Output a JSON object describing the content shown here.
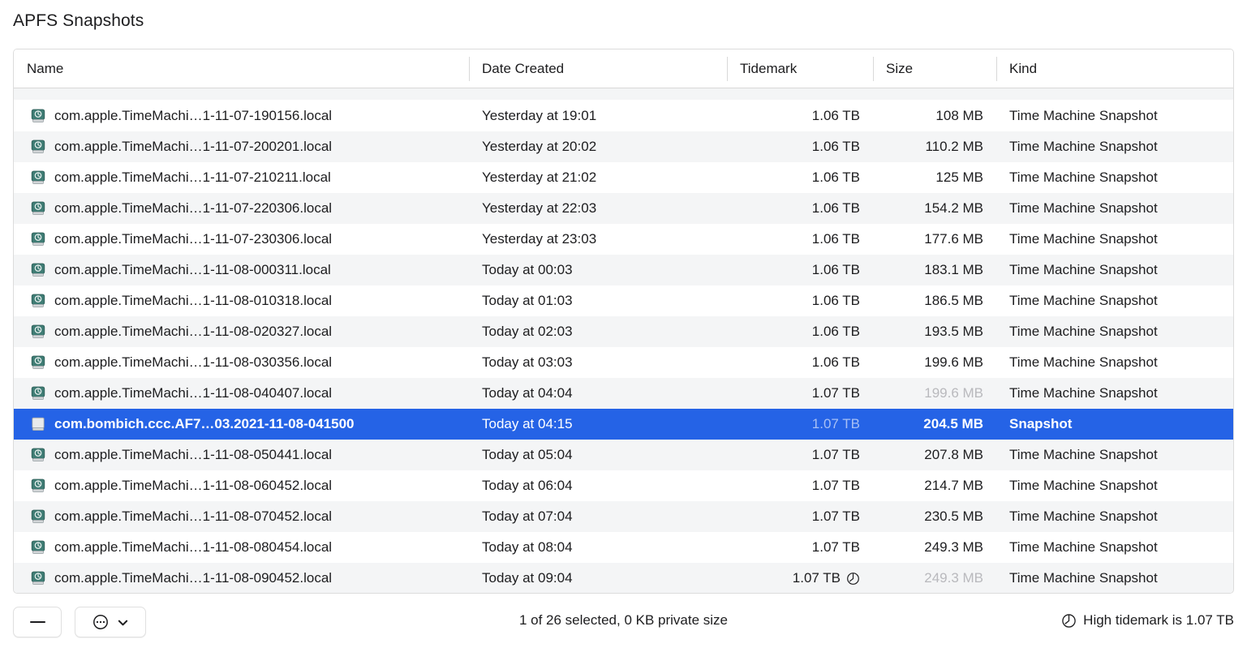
{
  "page_title": "APFS Snapshots",
  "colors": {
    "selection_blue": "#2563e6",
    "row_alt": "#f4f5f6",
    "text": "#1d1d1f",
    "dimmed_text": "#b9b9bd",
    "tm_disk_icon": "#3f7c74"
  },
  "table": {
    "columns": [
      {
        "key": "name",
        "label": "Name"
      },
      {
        "key": "date",
        "label": "Date Created"
      },
      {
        "key": "tidemark",
        "label": "Tidemark"
      },
      {
        "key": "size",
        "label": "Size"
      },
      {
        "key": "kind",
        "label": "Kind"
      }
    ],
    "rows": [
      {
        "icon": "time-machine-disk-icon",
        "name": "com.apple.TimeMachi…1-11-07-190156.local",
        "date": "Yesterday at 19:01",
        "tidemark": "1.06 TB",
        "tidemark_clock": false,
        "size": "108 MB",
        "size_dimmed": false,
        "kind": "Time Machine Snapshot",
        "selected": false
      },
      {
        "icon": "time-machine-disk-icon",
        "name": "com.apple.TimeMachi…1-11-07-200201.local",
        "date": "Yesterday at 20:02",
        "tidemark": "1.06 TB",
        "tidemark_clock": false,
        "size": "110.2 MB",
        "size_dimmed": false,
        "kind": "Time Machine Snapshot",
        "selected": false
      },
      {
        "icon": "time-machine-disk-icon",
        "name": "com.apple.TimeMachi…1-11-07-210211.local",
        "date": "Yesterday at 21:02",
        "tidemark": "1.06 TB",
        "tidemark_clock": false,
        "size": "125 MB",
        "size_dimmed": false,
        "kind": "Time Machine Snapshot",
        "selected": false
      },
      {
        "icon": "time-machine-disk-icon",
        "name": "com.apple.TimeMachi…1-11-07-220306.local",
        "date": "Yesterday at 22:03",
        "tidemark": "1.06 TB",
        "tidemark_clock": false,
        "size": "154.2 MB",
        "size_dimmed": false,
        "kind": "Time Machine Snapshot",
        "selected": false
      },
      {
        "icon": "time-machine-disk-icon",
        "name": "com.apple.TimeMachi…1-11-07-230306.local",
        "date": "Yesterday at 23:03",
        "tidemark": "1.06 TB",
        "tidemark_clock": false,
        "size": "177.6 MB",
        "size_dimmed": false,
        "kind": "Time Machine Snapshot",
        "selected": false
      },
      {
        "icon": "time-machine-disk-icon",
        "name": "com.apple.TimeMachi…1-11-08-000311.local",
        "date": "Today at 00:03",
        "tidemark": "1.06 TB",
        "tidemark_clock": false,
        "size": "183.1 MB",
        "size_dimmed": false,
        "kind": "Time Machine Snapshot",
        "selected": false
      },
      {
        "icon": "time-machine-disk-icon",
        "name": "com.apple.TimeMachi…1-11-08-010318.local",
        "date": "Today at 01:03",
        "tidemark": "1.06 TB",
        "tidemark_clock": false,
        "size": "186.5 MB",
        "size_dimmed": false,
        "kind": "Time Machine Snapshot",
        "selected": false
      },
      {
        "icon": "time-machine-disk-icon",
        "name": "com.apple.TimeMachi…1-11-08-020327.local",
        "date": "Today at 02:03",
        "tidemark": "1.06 TB",
        "tidemark_clock": false,
        "size": "193.5 MB",
        "size_dimmed": false,
        "kind": "Time Machine Snapshot",
        "selected": false
      },
      {
        "icon": "time-machine-disk-icon",
        "name": "com.apple.TimeMachi…1-11-08-030356.local",
        "date": "Today at 03:03",
        "tidemark": "1.06 TB",
        "tidemark_clock": false,
        "size": "199.6 MB",
        "size_dimmed": false,
        "kind": "Time Machine Snapshot",
        "selected": false
      },
      {
        "icon": "time-machine-disk-icon",
        "name": "com.apple.TimeMachi…1-11-08-040407.local",
        "date": "Today at 04:04",
        "tidemark": "1.07 TB",
        "tidemark_clock": false,
        "size": "199.6 MB",
        "size_dimmed": true,
        "kind": "Time Machine Snapshot",
        "selected": false
      },
      {
        "icon": "plain-disk-icon",
        "name": "com.bombich.ccc.AF7…03.2021-11-08-041500",
        "date": "Today at 04:15",
        "tidemark": "1.07 TB",
        "tidemark_clock": false,
        "size": "204.5 MB",
        "size_dimmed": false,
        "kind": "Snapshot",
        "selected": true,
        "tidemark_dimmed": true
      },
      {
        "icon": "time-machine-disk-icon",
        "name": "com.apple.TimeMachi…1-11-08-050441.local",
        "date": "Today at 05:04",
        "tidemark": "1.07 TB",
        "tidemark_clock": false,
        "size": "207.8 MB",
        "size_dimmed": false,
        "kind": "Time Machine Snapshot",
        "selected": false
      },
      {
        "icon": "time-machine-disk-icon",
        "name": "com.apple.TimeMachi…1-11-08-060452.local",
        "date": "Today at 06:04",
        "tidemark": "1.07 TB",
        "tidemark_clock": false,
        "size": "214.7 MB",
        "size_dimmed": false,
        "kind": "Time Machine Snapshot",
        "selected": false
      },
      {
        "icon": "time-machine-disk-icon",
        "name": "com.apple.TimeMachi…1-11-08-070452.local",
        "date": "Today at 07:04",
        "tidemark": "1.07 TB",
        "tidemark_clock": false,
        "size": "230.5 MB",
        "size_dimmed": false,
        "kind": "Time Machine Snapshot",
        "selected": false
      },
      {
        "icon": "time-machine-disk-icon",
        "name": "com.apple.TimeMachi…1-11-08-080454.local",
        "date": "Today at 08:04",
        "tidemark": "1.07 TB",
        "tidemark_clock": false,
        "size": "249.3 MB",
        "size_dimmed": false,
        "kind": "Time Machine Snapshot",
        "selected": false
      },
      {
        "icon": "time-machine-disk-icon",
        "name": "com.apple.TimeMachi…1-11-08-090452.local",
        "date": "Today at 09:04",
        "tidemark": "1.07 TB",
        "tidemark_clock": true,
        "size": "249.3 MB",
        "size_dimmed": true,
        "kind": "Time Machine Snapshot",
        "selected": false
      }
    ]
  },
  "footer": {
    "remove_button_label": "",
    "action_button_label": "",
    "status": "1 of 26 selected, 0 KB private size",
    "tidemark_note": "High tidemark is 1.07 TB"
  }
}
